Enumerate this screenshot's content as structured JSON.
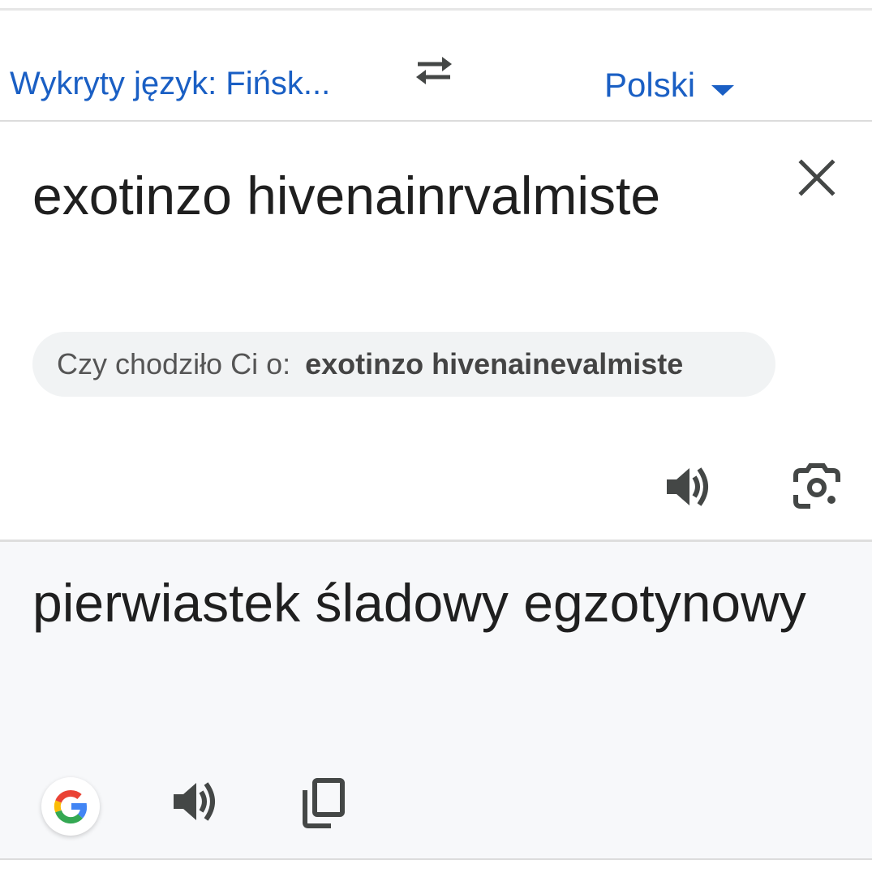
{
  "language_bar": {
    "source_language": "Wykryty język: Fińsk...",
    "target_language": "Polski"
  },
  "source": {
    "text": "exotinzo hivenainrvalmiste",
    "suggestion_prefix": "Czy chodziło Ci o:",
    "suggestion_value": "exotinzo hivenainevalmiste"
  },
  "translation": {
    "text": "pierwiastek śladowy egzotynowy"
  },
  "icons": {
    "swap": "swap-arrows-icon",
    "close": "close-icon",
    "speaker": "speaker-icon",
    "lens": "camera-lens-icon",
    "google": "google-g-icon",
    "copy": "copy-icon"
  },
  "colors": {
    "accent": "#1a5fc4",
    "icon": "#444746",
    "translation_background": "#f7f8fa",
    "suggestion_background": "#f1f3f4"
  }
}
